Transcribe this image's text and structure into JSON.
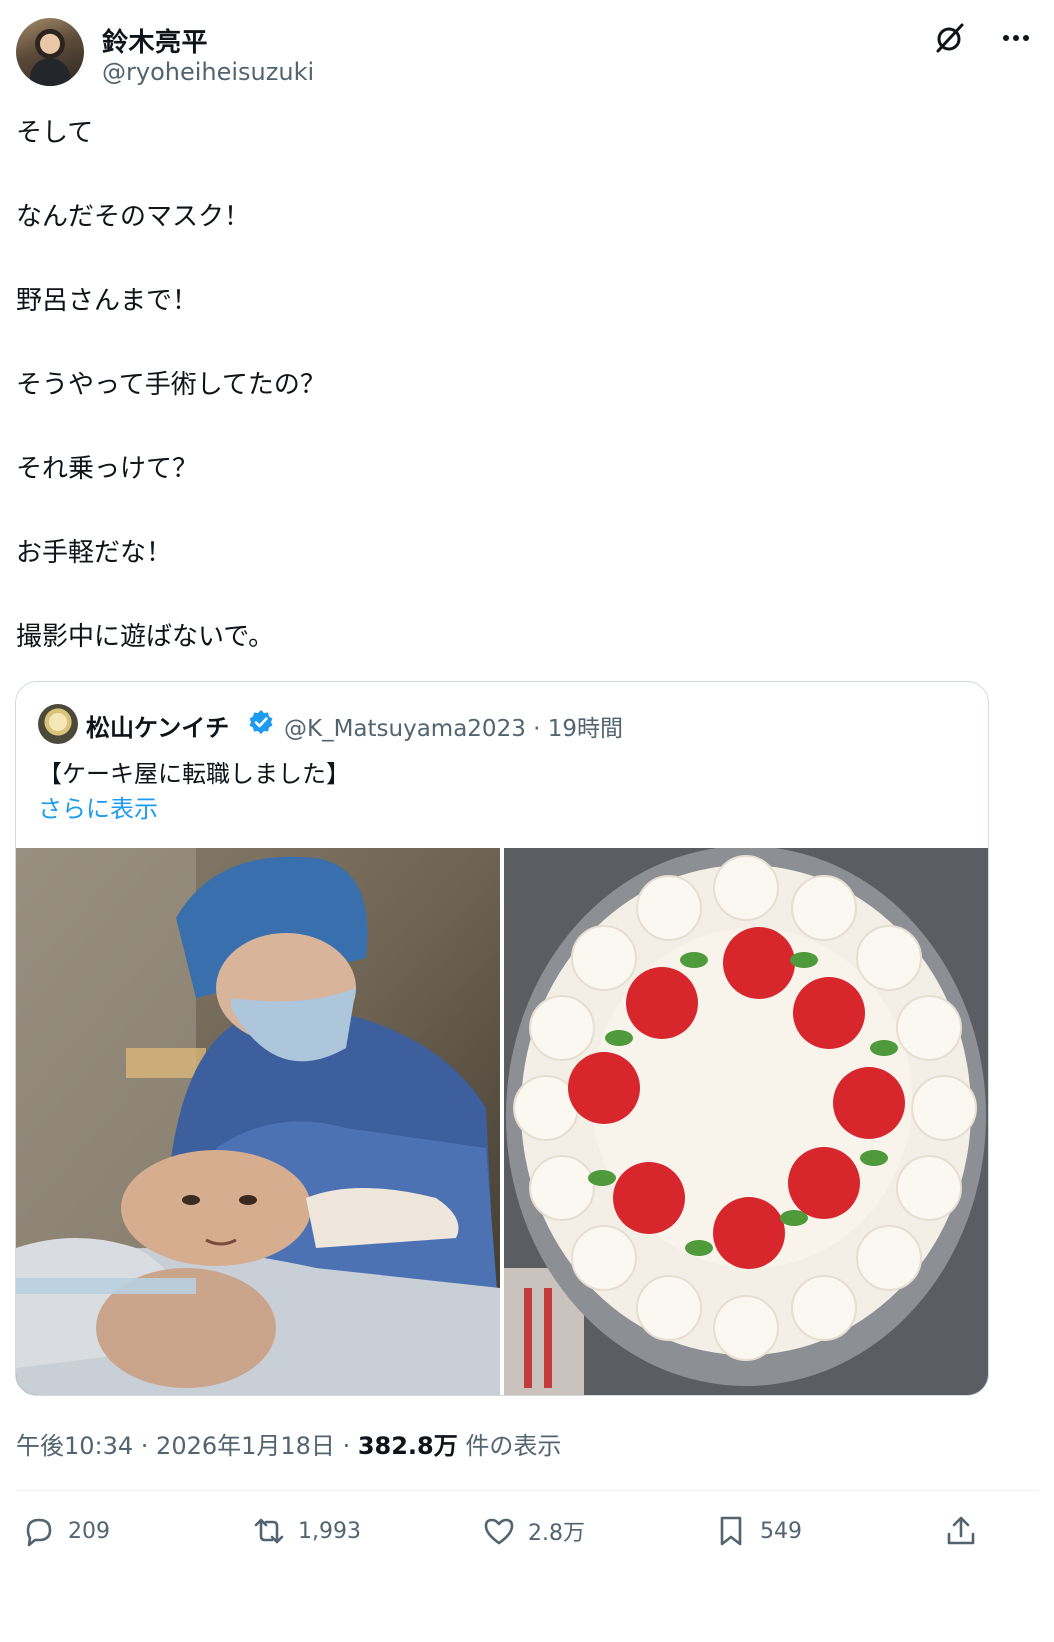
{
  "author": {
    "name": "鈴木亮平",
    "handle": "@ryoheiheisuzuki"
  },
  "tweet": {
    "lines": [
      "そして",
      "なんだそのマスク！",
      "野呂さんまで！",
      "そうやって手術してたの？",
      "それ乗っけて？",
      "お手軽だな！",
      "撮影中に遊ばないで。"
    ]
  },
  "quote": {
    "name": "松山ケンイチ",
    "handle_time": "@K_Matsuyama2023 · 19時間",
    "text": "【ケーキ屋に転職しました】",
    "show_more": "さらに表示"
  },
  "meta": {
    "time_date": "午後10:34 · 2026年1月18日 · ",
    "views": "382.8万",
    "views_suffix": " 件の表示"
  },
  "actions": {
    "replies": "209",
    "reposts": "1,993",
    "likes": "2.8万",
    "bookmarks": "549"
  },
  "icons": [
    "grok-icon",
    "more-icon",
    "verified-icon",
    "reply-icon",
    "repost-icon",
    "like-icon",
    "bookmark-icon",
    "share-icon"
  ],
  "colors": {
    "text": "#0f1419",
    "secondary": "#536471",
    "link": "#1d9bf0",
    "border": "#cfd9de"
  }
}
